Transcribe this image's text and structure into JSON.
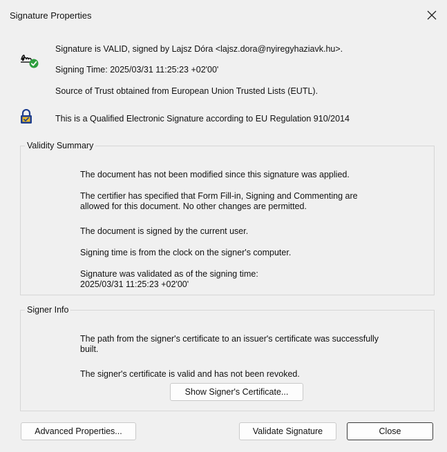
{
  "window": {
    "title": "Signature Properties"
  },
  "status": {
    "signed_by": "Signature is VALID, signed by Lajsz Dóra <lajsz.dora@nyiregyhaziavk.hu>.",
    "signing_time": "Signing Time:  2025/03/31 11:25:23 +02'00'",
    "source_of_trust": "Source of Trust obtained from European Union Trusted Lists (EUTL).",
    "qualified": "This is a Qualified Electronic Signature according to EU Regulation 910/2014"
  },
  "validity_summary": {
    "legend": "Validity Summary",
    "not_modified": "The document has not been modified since this signature was applied.",
    "certifier_line1": "The certifier has specified that Form Fill-in, Signing and Commenting are",
    "certifier_line2": "allowed for this document. No other changes are permitted.",
    "signed_by_current": "The document is signed by the current user.",
    "clock_source": "Signing time is from the clock on the signer's computer.",
    "validated_line1": "Signature was validated as of the signing time:",
    "validated_line2": "2025/03/31 11:25:23 +02'00'"
  },
  "signer_info": {
    "legend": "Signer Info",
    "path_line1": "The path from the signer's certificate to an issuer's certificate was successfully",
    "path_line2": "built.",
    "cert_valid": "The signer's certificate is valid and has not been revoked.",
    "show_cert_button": "Show Signer's Certificate..."
  },
  "footer": {
    "advanced_button": "Advanced Properties...",
    "validate_button": "Validate Signature",
    "close_button": "Close"
  },
  "colors": {
    "background": "#f0f0f0",
    "check_green": "#2e9e3e",
    "lock_blue": "#1f3f8f",
    "lock_gold": "#e8b92a"
  }
}
